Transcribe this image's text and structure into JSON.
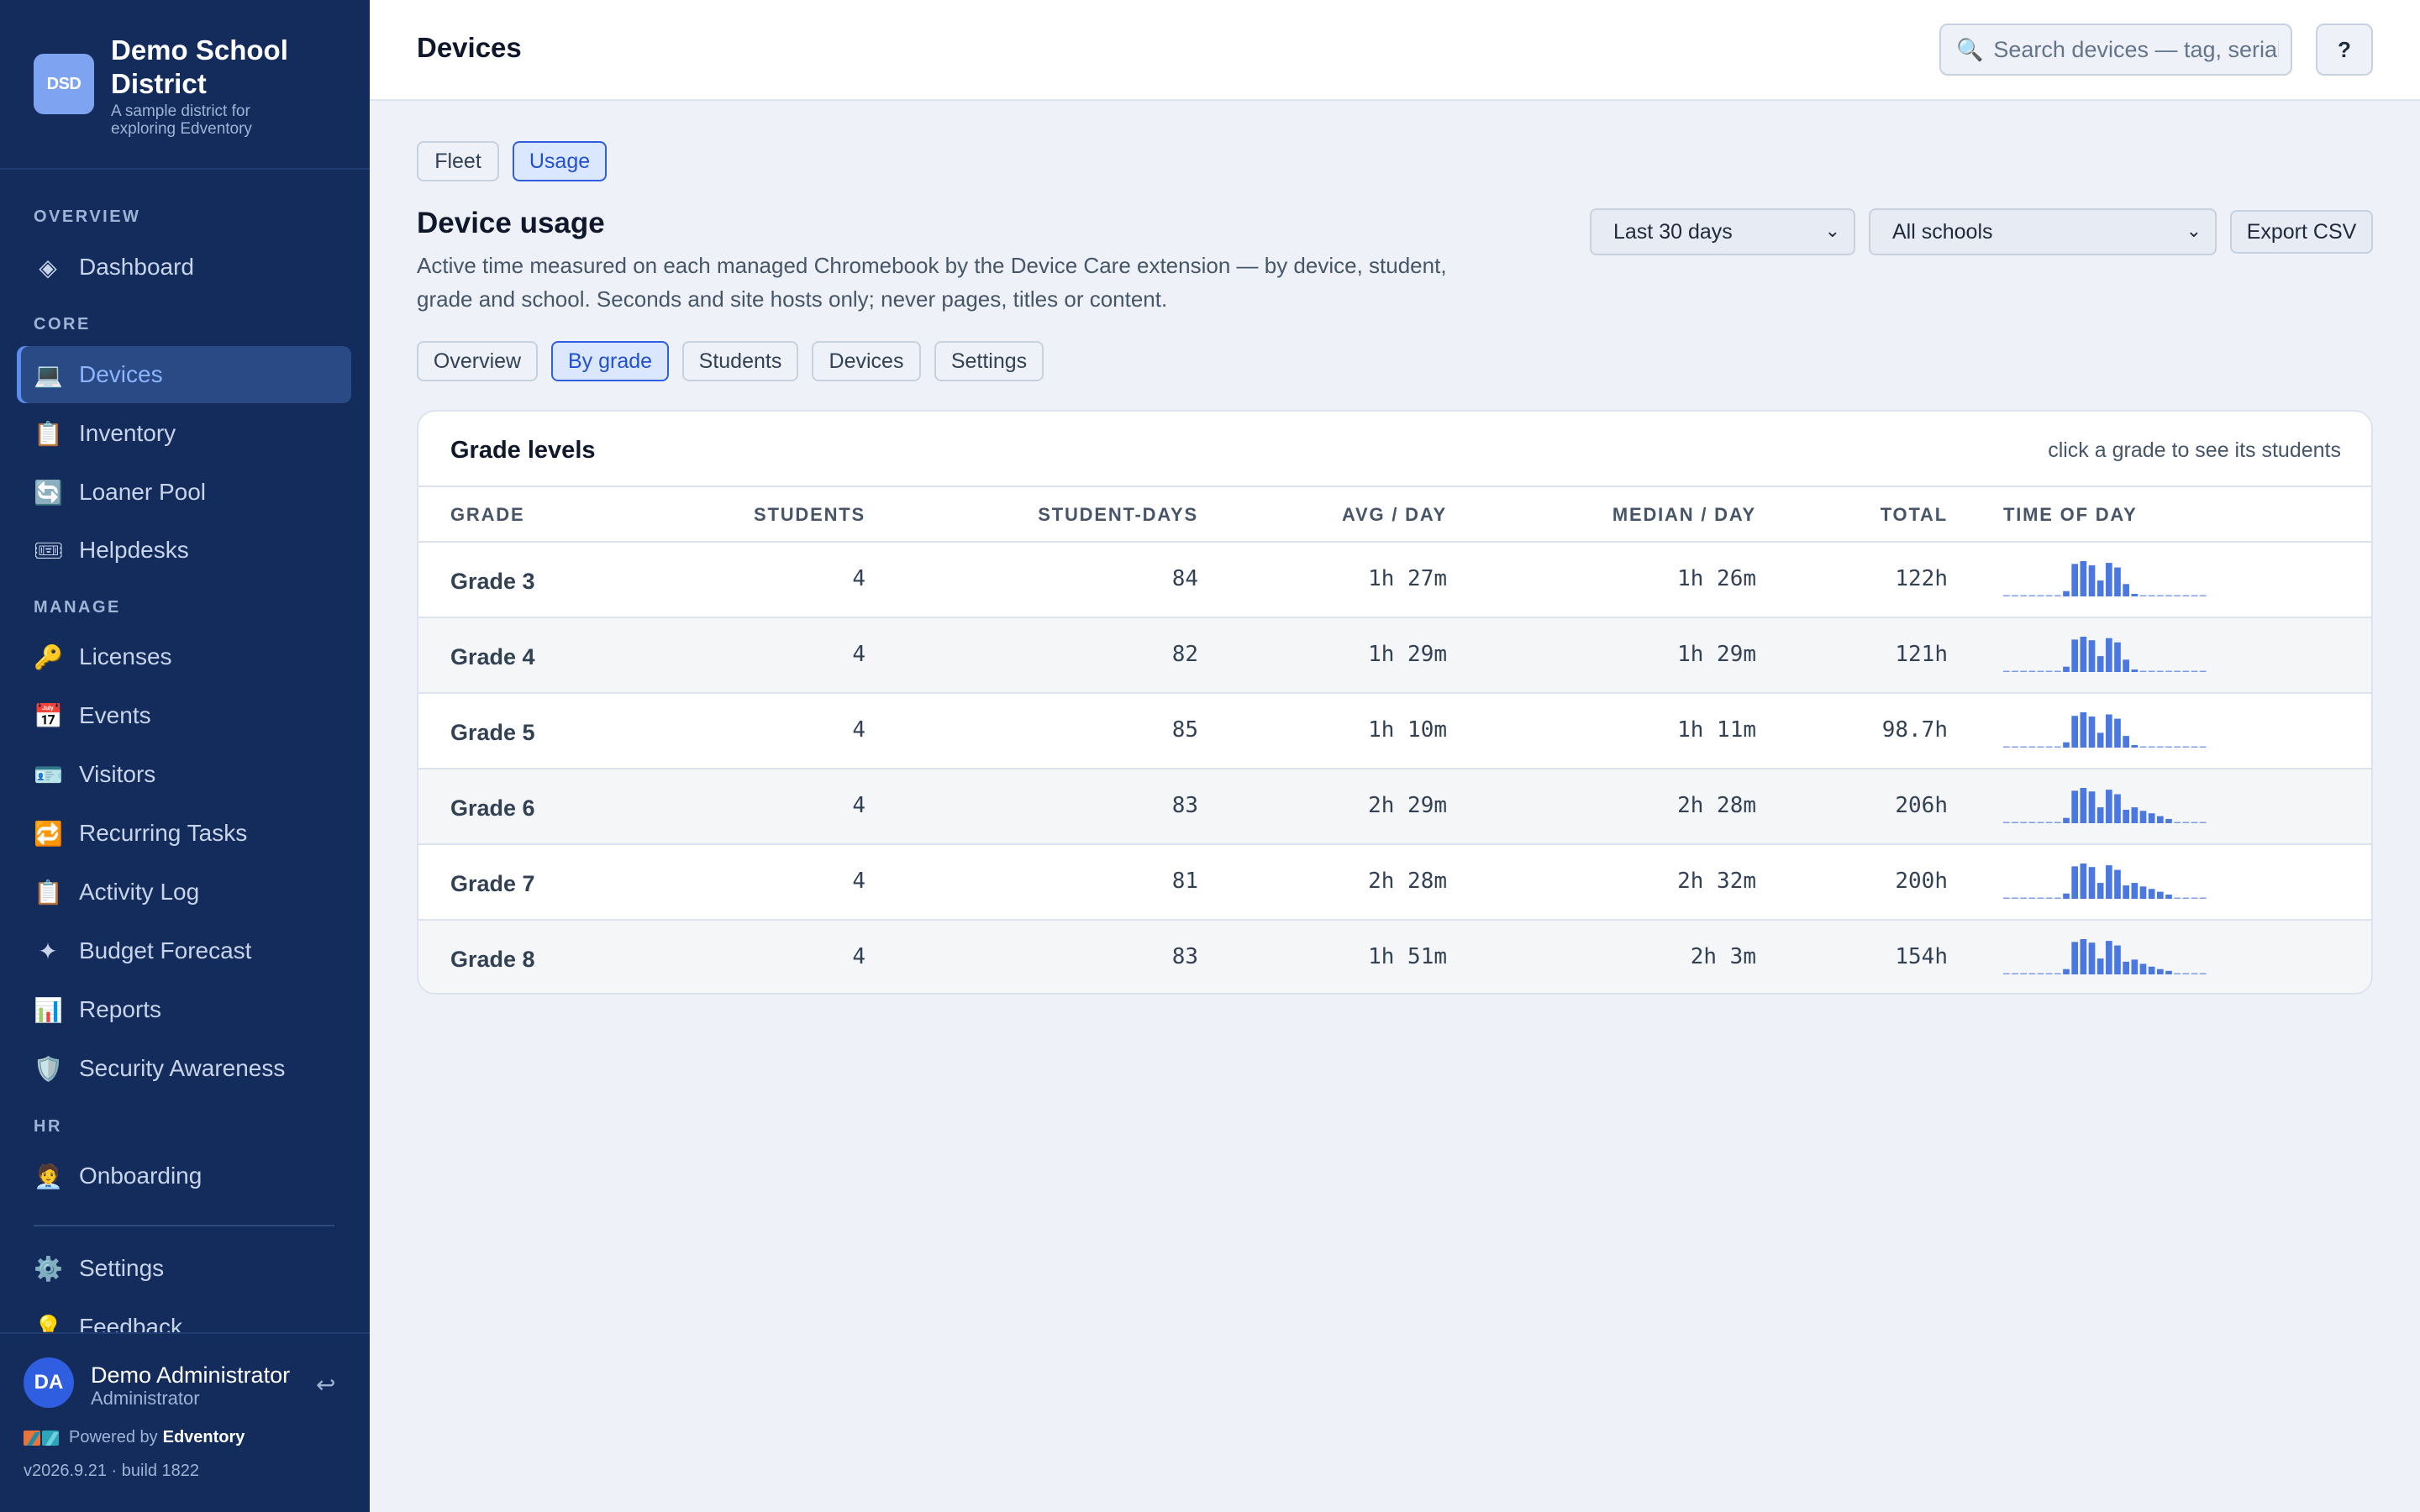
{
  "brand": {
    "logo_text": "DSD",
    "name": "Demo School District",
    "subtitle": "A sample district for exploring Edventory"
  },
  "sidebar": {
    "sections": {
      "overview": "OVERVIEW",
      "core": "CORE",
      "manage": "MANAGE",
      "hr": "HR"
    },
    "items": [
      {
        "label": "Dashboard",
        "icon": "◈",
        "icon_name": "dashboard-icon"
      },
      {
        "label": "Devices",
        "icon": "💻",
        "icon_name": "laptop-icon",
        "active": true
      },
      {
        "label": "Inventory",
        "icon": "📋",
        "icon_name": "clipboard-icon"
      },
      {
        "label": "Loaner Pool",
        "icon": "🔄",
        "icon_name": "swap-icon"
      },
      {
        "label": "Helpdesks",
        "icon": "🎟",
        "icon_name": "ticket-icon"
      },
      {
        "label": "Licenses",
        "icon": "🔑",
        "icon_name": "key-icon"
      },
      {
        "label": "Events",
        "icon": "📅",
        "icon_name": "calendar-icon"
      },
      {
        "label": "Visitors",
        "icon": "🪪",
        "icon_name": "id-card-icon"
      },
      {
        "label": "Recurring Tasks",
        "icon": "🔁",
        "icon_name": "repeat-icon"
      },
      {
        "label": "Activity Log",
        "icon": "📋",
        "icon_name": "clipboard-icon"
      },
      {
        "label": "Budget Forecast",
        "icon": "✦",
        "icon_name": "sparkle-icon"
      },
      {
        "label": "Reports",
        "icon": "📊",
        "icon_name": "bar-chart-icon"
      },
      {
        "label": "Security Awareness",
        "icon": "🛡️",
        "icon_name": "shield-icon"
      },
      {
        "label": "Onboarding",
        "icon": "🧑‍💼",
        "icon_name": "person-icon"
      },
      {
        "label": "Settings",
        "icon": "⚙️",
        "icon_name": "gear-icon"
      },
      {
        "label": "Feedback",
        "icon": "💡",
        "icon_name": "lightbulb-icon"
      }
    ]
  },
  "user": {
    "initials": "DA",
    "name": "Demo Administrator",
    "role": "Administrator",
    "logout_icon": "↩"
  },
  "footer": {
    "powered_prefix": "Powered by",
    "powered_brand": "Edventory",
    "version": "v2026.9.21 · build 1822"
  },
  "topbar": {
    "title": "Devices",
    "search_placeholder": "Search devices — tag, serial",
    "search_icon": "🔍",
    "help_label": "?"
  },
  "main_tabs": [
    {
      "label": "Fleet",
      "active": false
    },
    {
      "label": "Usage",
      "active": true
    }
  ],
  "usage": {
    "title": "Device usage",
    "description": "Active time measured on each managed Chromebook by the Device Care extension — by device, student, grade and school. Seconds and site hosts only; never pages, titles or content.",
    "range_select": "Last 30 days",
    "school_select": "All schools",
    "export_label": "Export CSV",
    "sub_tabs": [
      {
        "label": "Overview",
        "active": false
      },
      {
        "label": "By grade",
        "active": true
      },
      {
        "label": "Students",
        "active": false
      },
      {
        "label": "Devices",
        "active": false
      },
      {
        "label": "Settings",
        "active": false
      }
    ]
  },
  "grade_table": {
    "title": "Grade levels",
    "hint": "click a grade to see its students",
    "columns": [
      "GRADE",
      "STUDENTS",
      "STUDENT-DAYS",
      "AVG / DAY",
      "MEDIAN / DAY",
      "TOTAL",
      "TIME OF DAY"
    ],
    "accent_color": "#4a78e0",
    "rows": [
      {
        "grade": "Grade 3",
        "students": "4",
        "student_days": "84",
        "avg": "1h 27m",
        "median": "1h 26m",
        "total": "122h",
        "hourly": [
          0,
          0,
          0,
          0,
          0,
          0,
          0,
          0.15,
          0.92,
          1.0,
          0.88,
          0.45,
          0.95,
          0.82,
          0.35,
          0.06,
          0,
          0,
          0,
          0,
          0,
          0,
          0,
          0
        ]
      },
      {
        "grade": "Grade 4",
        "students": "4",
        "student_days": "82",
        "avg": "1h 29m",
        "median": "1h 29m",
        "total": "121h",
        "hourly": [
          0,
          0,
          0,
          0,
          0,
          0,
          0,
          0.15,
          0.92,
          1.0,
          0.9,
          0.45,
          0.96,
          0.84,
          0.35,
          0.06,
          0,
          0,
          0,
          0,
          0,
          0,
          0,
          0
        ]
      },
      {
        "grade": "Grade 5",
        "students": "4",
        "student_days": "85",
        "avg": "1h 10m",
        "median": "1h 11m",
        "total": "98.7h",
        "hourly": [
          0,
          0,
          0,
          0,
          0,
          0,
          0,
          0.15,
          0.9,
          1.0,
          0.88,
          0.42,
          0.94,
          0.82,
          0.33,
          0.06,
          0,
          0,
          0,
          0,
          0,
          0,
          0,
          0
        ]
      },
      {
        "grade": "Grade 6",
        "students": "4",
        "student_days": "83",
        "avg": "2h 29m",
        "median": "2h 28m",
        "total": "206h",
        "hourly": [
          0,
          0,
          0,
          0,
          0,
          0,
          0,
          0.15,
          0.92,
          1.0,
          0.9,
          0.45,
          0.95,
          0.82,
          0.38,
          0.45,
          0.35,
          0.28,
          0.2,
          0.12,
          0,
          0,
          0,
          0
        ]
      },
      {
        "grade": "Grade 7",
        "students": "4",
        "student_days": "81",
        "avg": "2h 28m",
        "median": "2h 32m",
        "total": "200h",
        "hourly": [
          0,
          0,
          0,
          0,
          0,
          0,
          0,
          0.15,
          0.92,
          1.0,
          0.9,
          0.45,
          0.95,
          0.82,
          0.38,
          0.45,
          0.35,
          0.28,
          0.2,
          0.12,
          0,
          0,
          0,
          0
        ]
      },
      {
        "grade": "Grade 8",
        "students": "4",
        "student_days": "83",
        "avg": "1h 51m",
        "median": "2h 3m",
        "total": "154h",
        "hourly": [
          0,
          0,
          0,
          0,
          0,
          0,
          0,
          0.15,
          0.92,
          1.0,
          0.9,
          0.45,
          0.95,
          0.82,
          0.36,
          0.42,
          0.3,
          0.22,
          0.15,
          0.1,
          0,
          0,
          0,
          0
        ]
      }
    ]
  }
}
